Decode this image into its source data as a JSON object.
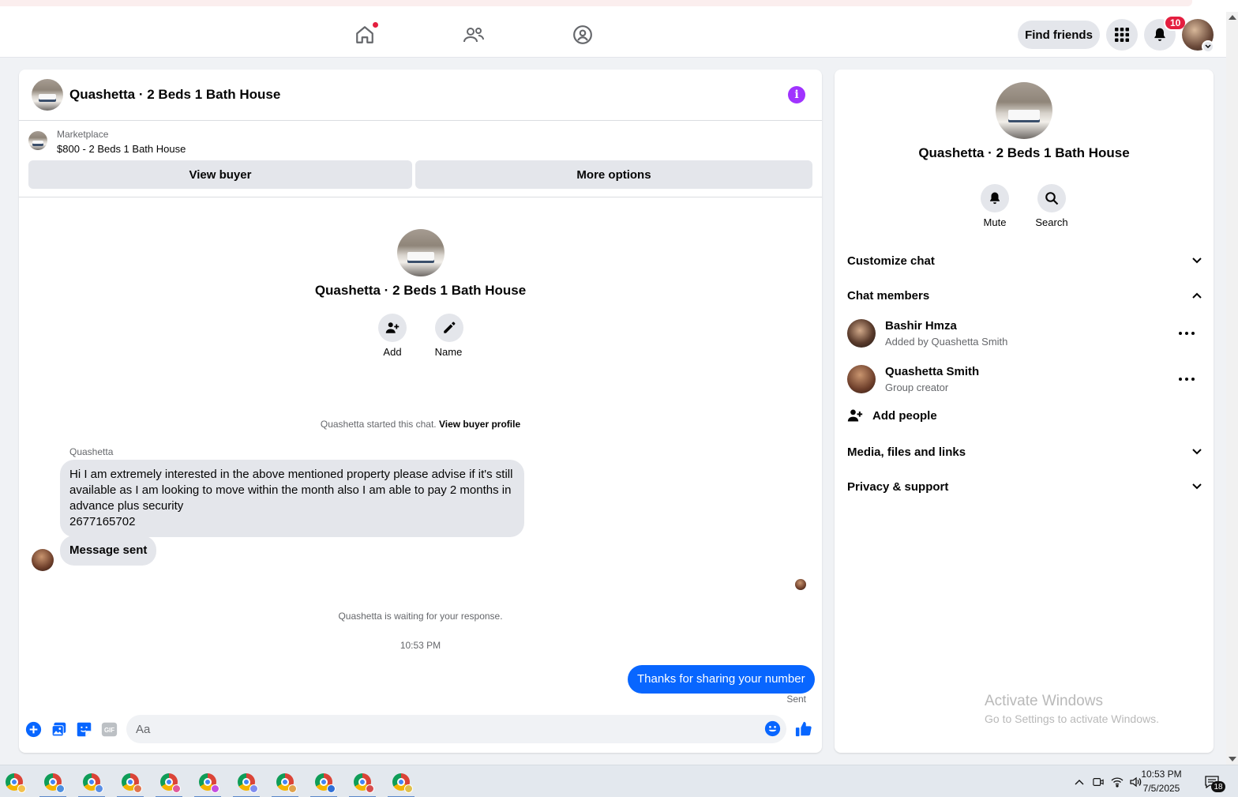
{
  "topbar": {
    "find_friends": "Find friends",
    "notification_count": "10",
    "icons": [
      "home-icon",
      "friends-icon",
      "groups-icon",
      "menu-grid-icon",
      "bell-icon"
    ]
  },
  "chat": {
    "header_title": "Quashetta · 2 Beds 1 Bath House",
    "marketplace_label": "Marketplace",
    "listing_price": "$800 - 2 Beds 1 Bath House",
    "view_buyer": "View buyer",
    "more_options": "More options",
    "center_title": "Quashetta · 2 Beds 1 Bath House",
    "add_label": "Add",
    "name_label": "Name",
    "started_text": "Quashetta started this chat.",
    "view_buyer_profile": "View buyer profile",
    "sender_name": "Quashetta",
    "message_1_lines": [
      "Hi I am extremely interested in the above mentioned property please advise if it's still",
      "available as I am looking to move within the month also I am able to pay 2 months in",
      "advance plus security",
      "2677165702"
    ],
    "message_2": "Message sent",
    "waiting_text": "Quashetta is waiting for your response.",
    "timestamp": "10:53 PM",
    "outgoing_message": "Thanks for sharing your number",
    "sent_status": "Sent",
    "composer_placeholder": "Aa"
  },
  "info_panel": {
    "title": "Quashetta · 2 Beds 1 Bath House",
    "mute": "Mute",
    "search": "Search",
    "customize_chat": "Customize chat",
    "chat_members": "Chat members",
    "members": [
      {
        "name": "Bashir Hmza",
        "subtitle": "Added by Quashetta Smith"
      },
      {
        "name": "Quashetta Smith",
        "subtitle": "Group creator"
      }
    ],
    "add_people": "Add people",
    "media_files_links": "Media, files and links",
    "privacy_support": "Privacy & support"
  },
  "watermark": {
    "line1": "Activate Windows",
    "line2": "Go to Settings to activate Windows."
  },
  "taskbar": {
    "time": "10:53 PM",
    "date": "7/5/2025",
    "notification_count": "18",
    "profile_colors": [
      "#f2c14e",
      "#4d8fe0",
      "#5a8fe6",
      "#e0734d",
      "#e05a9a",
      "#c34de0",
      "#7e8cf0",
      "#e0a24d",
      "#2f6fd6",
      "#d64d4d",
      "#e0c04d"
    ]
  }
}
